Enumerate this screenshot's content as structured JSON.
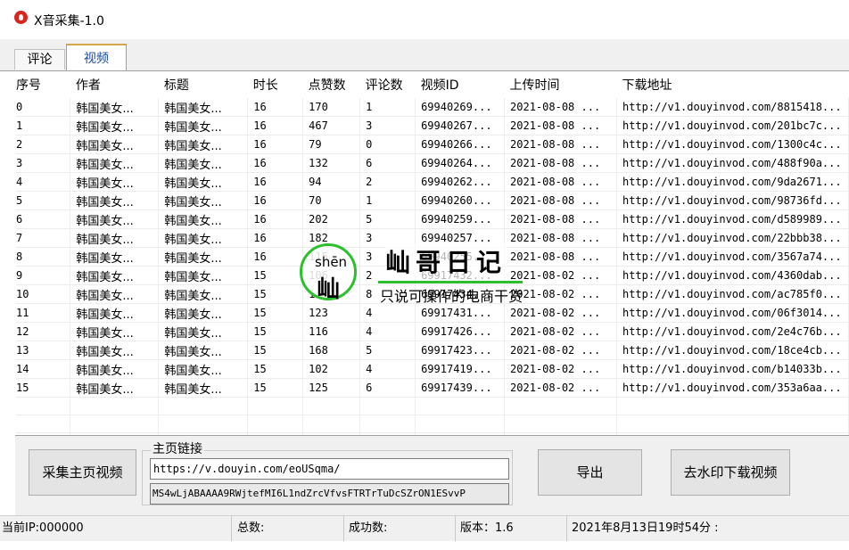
{
  "window": {
    "title": "X音采集-1.0"
  },
  "tabs": [
    {
      "label": "评论",
      "active": false
    },
    {
      "label": "视频",
      "active": true
    }
  ],
  "table": {
    "columns": [
      "序号",
      "作者",
      "标题",
      "时长",
      "点赞数",
      "评论数",
      "视频ID",
      "上传时间",
      "下载地址"
    ],
    "rows": [
      [
        "0",
        "韩国美女...",
        "韩国美女...",
        "16",
        "170",
        "1",
        "69940269...",
        "2021-08-08 ...",
        "http://v1.douyinvod.com/8815418..."
      ],
      [
        "1",
        "韩国美女...",
        "韩国美女...",
        "16",
        "467",
        "3",
        "69940267...",
        "2021-08-08 ...",
        "http://v1.douyinvod.com/201bc7c..."
      ],
      [
        "2",
        "韩国美女...",
        "韩国美女...",
        "16",
        "79",
        "0",
        "69940266...",
        "2021-08-08 ...",
        "http://v1.douyinvod.com/1300c4c..."
      ],
      [
        "3",
        "韩国美女...",
        "韩国美女...",
        "16",
        "132",
        "6",
        "69940264...",
        "2021-08-08 ...",
        "http://v1.douyinvod.com/488f90a..."
      ],
      [
        "4",
        "韩国美女...",
        "韩国美女...",
        "16",
        "94",
        "2",
        "69940262...",
        "2021-08-08 ...",
        "http://v1.douyinvod.com/9da2671..."
      ],
      [
        "5",
        "韩国美女...",
        "韩国美女...",
        "16",
        "70",
        "1",
        "69940260...",
        "2021-08-08 ...",
        "http://v1.douyinvod.com/98736fd..."
      ],
      [
        "6",
        "韩国美女...",
        "韩国美女...",
        "16",
        "202",
        "5",
        "69940259...",
        "2021-08-08 ...",
        "http://v1.douyinvod.com/d589989..."
      ],
      [
        "7",
        "韩国美女...",
        "韩国美女...",
        "16",
        "182",
        "3",
        "69940257...",
        "2021-08-08 ...",
        "http://v1.douyinvod.com/22bbb38..."
      ],
      [
        "8",
        "韩国美女...",
        "韩国美女...",
        "16",
        "115",
        "3",
        "69940255...",
        "2021-08-08 ...",
        "http://v1.douyinvod.com/3567a74..."
      ],
      [
        "9",
        "韩国美女...",
        "韩国美女...",
        "15",
        "106",
        "2",
        "69917432...",
        "2021-08-02 ...",
        "http://v1.douyinvod.com/4360dab..."
      ],
      [
        "10",
        "韩国美女...",
        "韩国美女...",
        "15",
        "1",
        "8",
        "69917434...",
        "2021-08-02 ...",
        "http://v1.douyinvod.com/ac785f0..."
      ],
      [
        "11",
        "韩国美女...",
        "韩国美女...",
        "15",
        "123",
        "4",
        "69917431...",
        "2021-08-02 ...",
        "http://v1.douyinvod.com/06f3014..."
      ],
      [
        "12",
        "韩国美女...",
        "韩国美女...",
        "15",
        "116",
        "4",
        "69917426...",
        "2021-08-02 ...",
        "http://v1.douyinvod.com/2e4c76b..."
      ],
      [
        "13",
        "韩国美女...",
        "韩国美女...",
        "15",
        "168",
        "5",
        "69917423...",
        "2021-08-02 ...",
        "http://v1.douyinvod.com/18ce4cb..."
      ],
      [
        "14",
        "韩国美女...",
        "韩国美女...",
        "15",
        "102",
        "4",
        "69917419...",
        "2021-08-02 ...",
        "http://v1.douyinvod.com/b14033b..."
      ],
      [
        "15",
        "韩国美女...",
        "韩国美女...",
        "15",
        "125",
        "6",
        "69917439...",
        "2021-08-02 ...",
        "http://v1.douyinvod.com/353a6aa..."
      ]
    ]
  },
  "watermark": {
    "pinyin": "shēn",
    "char": "屾",
    "name": "屾哥日记",
    "slogan": "只说可操作的电商干货"
  },
  "controls": {
    "collect_button": "采集主页视频",
    "homepage_label": "主页链接",
    "homepage_url": "https://v.douyin.com/eoUSqma/",
    "token_value": "MS4wLjABAAAA9RWjtefMI6L1ndZrcVfvsFTRTrTuDcSZrON1ESvvP",
    "export_button": "导出",
    "download_button": "去水印下载视频"
  },
  "statusbar": {
    "ip": "当前IP:000000",
    "total": "总数:",
    "success": "成功数:",
    "version": "版本：1.6",
    "datetime": "2021年8月13日19时54分 :"
  },
  "colors": {
    "app_icon": "#d7261e",
    "active_tab_accent": "#d8a64a",
    "watermark_green": "#2bc02b"
  }
}
